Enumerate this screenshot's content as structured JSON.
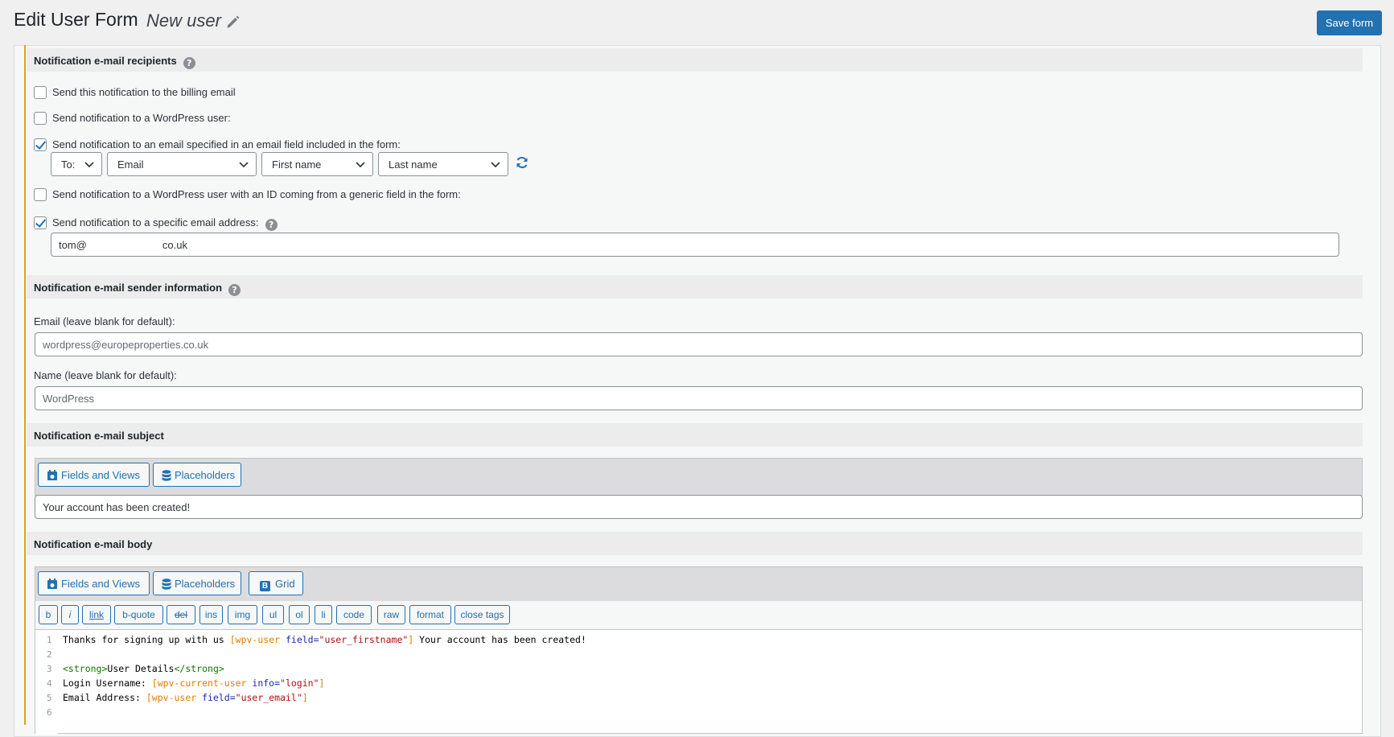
{
  "header": {
    "title": "Edit User Form",
    "subtitle": "New user",
    "save_label": "Save form"
  },
  "recipients": {
    "heading": "Notification e-mail recipients",
    "help": "?",
    "options": [
      {
        "label": "Send this notification to the billing email",
        "checked": false
      },
      {
        "label": "Send notification to a WordPress user:",
        "checked": false
      },
      {
        "label": "Send notification to an email specified in an email field included in the form:",
        "checked": true
      },
      {
        "label": "Send notification to a WordPress user with an ID coming from a generic field in the form:",
        "checked": false
      },
      {
        "label": "Send notification to a specific email address:",
        "checked": true
      }
    ],
    "selects": {
      "to": "To:",
      "email_field": "Email",
      "first_name": "First name",
      "last_name": "Last name"
    },
    "specific_email_part1": "tom@",
    "specific_email_part2": "co.uk"
  },
  "sender": {
    "heading": "Notification e-mail sender information",
    "help": "?",
    "email_label": "Email (leave blank for default):",
    "email_placeholder": "wordpress@europeproperties.co.uk",
    "name_label": "Name (leave blank for default):",
    "name_placeholder": "WordPress"
  },
  "subject": {
    "heading": "Notification e-mail subject",
    "fields_views": "Fields and Views",
    "placeholders": "Placeholders",
    "value": "Your account has been created!"
  },
  "body": {
    "heading": "Notification e-mail body",
    "fields_views": "Fields and Views",
    "placeholders": "Placeholders",
    "grid": "Grid",
    "grid_icon": "B",
    "quicktags": [
      "b",
      "i",
      "link",
      "b-quote",
      "del",
      "ins",
      "img",
      "ul",
      "ol",
      "li",
      "code",
      "raw",
      "format",
      "close tags"
    ],
    "line_numbers": [
      "1",
      "2",
      "3",
      "4",
      "5",
      "6"
    ],
    "code": {
      "l1_a": "Thanks for signing up with us ",
      "l1_sc": "[wpv-user ",
      "l1_attr": "field=",
      "l1_str": "\"user_firstname\"",
      "l1_end": "]",
      "l1_b": " Your account has been created!",
      "l3_open": "<strong>",
      "l3_text": "User Details",
      "l3_close": "</strong>",
      "l4_a": "Login Username: ",
      "l4_sc": "[wpv-current-user ",
      "l4_attr": "info=",
      "l4_str": "\"login\"",
      "l4_end": "]",
      "l5_a": "Email Address: ",
      "l5_sc": "[wpv-user ",
      "l5_attr": "field=",
      "l5_str": "\"user_email\"",
      "l5_end": "]"
    }
  }
}
